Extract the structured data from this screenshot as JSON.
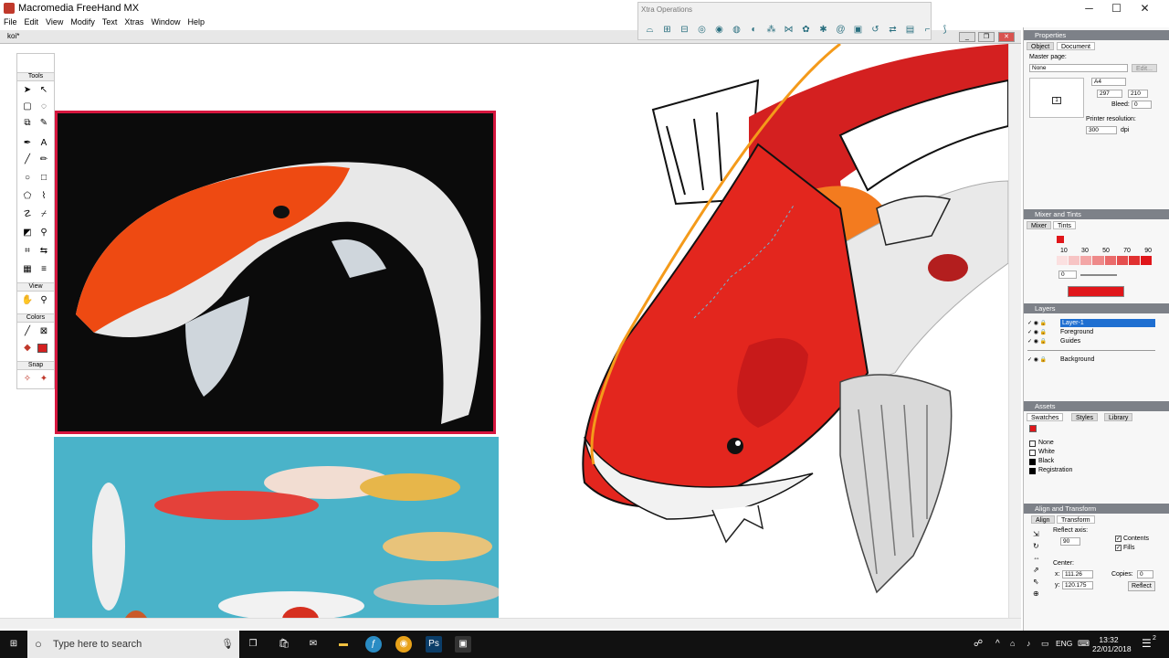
{
  "app": {
    "title": "Macromedia FreeHand MX"
  },
  "window_controls": {
    "minimize": "─",
    "maximize": "☐",
    "close": "✕"
  },
  "menu": [
    "File",
    "Edit",
    "View",
    "Modify",
    "Text",
    "Xtras",
    "Window",
    "Help"
  ],
  "document": {
    "tab_label": "koi*"
  },
  "xtra_panel": {
    "title": "Xtra Operations"
  },
  "tools_panel": {
    "title": "Tools",
    "view_label": "View",
    "colors_label": "Colors",
    "snap_label": "Snap"
  },
  "properties_panel": {
    "title": "Properties",
    "tabs": [
      "Object",
      "Document"
    ],
    "master_page_label": "Master page:",
    "master_page_value": "None",
    "edit_button": "Edit...",
    "page_size_value": "A4",
    "width_value": "297",
    "height_value": "210",
    "bleed_label": "Bleed:",
    "bleed_value": "0",
    "printer_resolution_label": "Printer resolution:",
    "printer_resolution_value": "300",
    "dpi_label": "dpi",
    "page_number": "1"
  },
  "mixer_panel": {
    "title": "Mixer and Tints",
    "tabs": [
      "Mixer",
      "Tints"
    ],
    "tint_labels": [
      "10",
      "30",
      "50",
      "70",
      "90"
    ],
    "tint_value": "0",
    "base_color": "#e0161a"
  },
  "layers_panel": {
    "title": "Layers",
    "layers": [
      "Layer-1",
      "Foreground",
      "Guides",
      "Background"
    ]
  },
  "assets_panel": {
    "title": "Assets",
    "tabs": [
      "Swatches",
      "Styles",
      "Library"
    ],
    "swatches": [
      "None",
      "White",
      "Black",
      "Registration"
    ]
  },
  "align_panel": {
    "title": "Align and Transform",
    "tabs": [
      "Align",
      "Transform"
    ],
    "reflect_axis_label": "Reflect axis:",
    "reflect_axis_value": "90",
    "contents_label": "Contents",
    "fills_label": "Fills",
    "center_label": "Center:",
    "x_label": "x:",
    "x_value": "111.26",
    "y_label": "y:",
    "y_value": "120.175",
    "copies_label": "Copies:",
    "copies_value": "0",
    "reflect_button": "Reflect"
  },
  "taskbar": {
    "search_placeholder": "Type here to search",
    "language": "ENG",
    "time": "13:32",
    "date": "22/01/2018",
    "notification_count": "2"
  }
}
